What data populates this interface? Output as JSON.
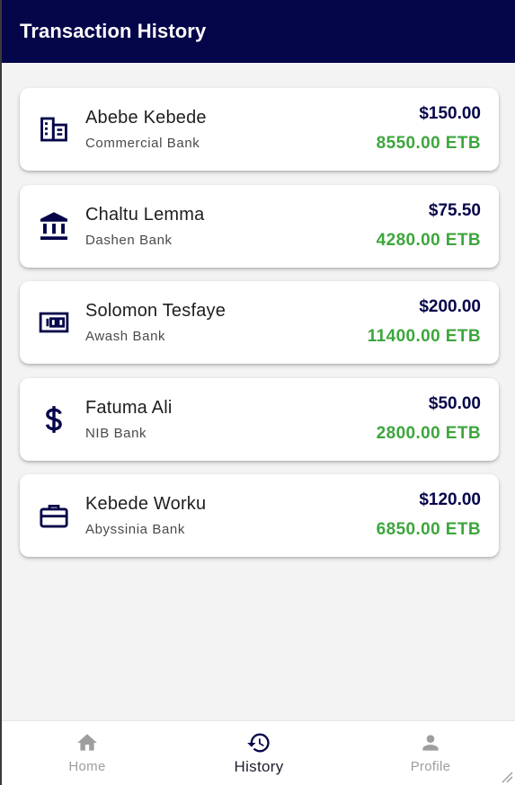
{
  "appbar": {
    "title": "Transaction History"
  },
  "transactions": [
    {
      "name": "Abebe Kebede",
      "bank": "Commercial Bank",
      "usd": "$150.00",
      "etb": "8550.00 ETB",
      "icon": "business-icon"
    },
    {
      "name": "Chaltu Lemma",
      "bank": "Dashen Bank",
      "usd": "$75.50",
      "etb": "4280.00 ETB",
      "icon": "bank-icon"
    },
    {
      "name": "Solomon Tesfaye",
      "bank": "Awash Bank",
      "usd": "$200.00",
      "etb": "11400.00 ETB",
      "icon": "money-bill-icon"
    },
    {
      "name": "Fatuma Ali",
      "bank": "NIB Bank",
      "usd": "$50.00",
      "etb": "2800.00 ETB",
      "icon": "dollar-icon"
    },
    {
      "name": "Kebede Worku",
      "bank": "Abyssinia Bank",
      "usd": "$120.00",
      "etb": "6850.00 ETB",
      "icon": "briefcase-icon"
    }
  ],
  "navbar": {
    "items": [
      {
        "label": "Home",
        "icon": "home-icon",
        "active": false
      },
      {
        "label": "History",
        "icon": "history-icon",
        "active": true
      },
      {
        "label": "Profile",
        "icon": "person-icon",
        "active": false
      }
    ]
  },
  "colors": {
    "primary": "#05054a",
    "etb_green": "#3da63d",
    "background": "#f3f3f3",
    "inactive_nav": "#9e9e9e"
  }
}
